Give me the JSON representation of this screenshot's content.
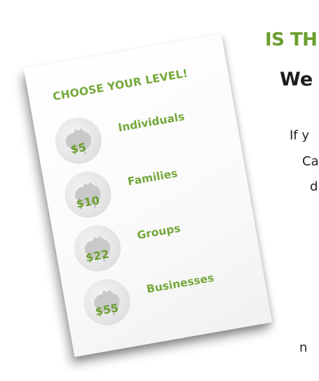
{
  "article": {
    "heading_fragment": "IS TH",
    "subheading_fragment": "We",
    "body_fragments": [
      "If y",
      "Ca",
      "d",
      "n"
    ]
  },
  "card": {
    "title": "CHOOSE YOUR LEVEL!",
    "levels": [
      {
        "price": "$5",
        "label": "Individuals",
        "badge_icon": "australia-map-icon"
      },
      {
        "price": "$10",
        "label": "Families",
        "badge_icon": "australia-map-icon"
      },
      {
        "price": "$22",
        "label": "Groups",
        "badge_icon": "australia-map-icon"
      },
      {
        "price": "$55",
        "label": "Businesses",
        "badge_icon": "australia-map-icon"
      }
    ]
  },
  "colors": {
    "accent_green": "#74a83a",
    "heading_green": "#6a9e2e",
    "text_dark": "#1c1c1c"
  }
}
